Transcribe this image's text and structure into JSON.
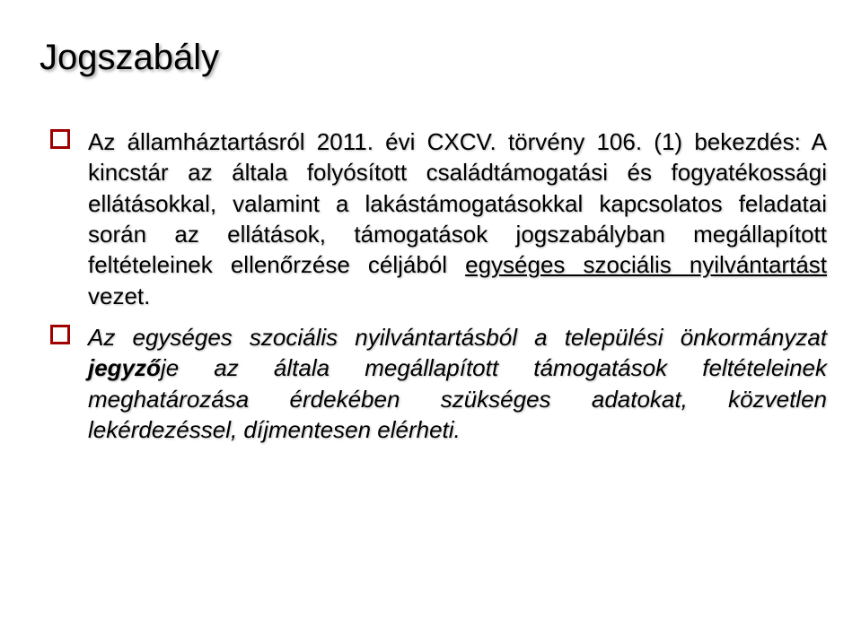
{
  "title": "Jogszabály",
  "items": [
    {
      "segments": [
        {
          "text": "Az államháztartásról 2011. évi CXCV. törvény 106. (1) bekezdés: A kincstár az általa folyósított családtámogatási és fogyatékossági ellátásokkal, valamint a lakástámogatásokkal kapcsolatos feladatai során az ellátások, támogatások jogszabályban megállapított feltételeinek ellenőrzése céljából ",
          "underline": false,
          "bold": false,
          "italic": false
        },
        {
          "text": "egységes szociális nyilvántartást",
          "underline": true,
          "bold": false,
          "italic": false
        },
        {
          "text": " vezet.",
          "underline": false,
          "bold": false,
          "italic": false
        }
      ]
    },
    {
      "segments": [
        {
          "text": "Az egységes szociális nyilvántartásból a települési önkormányzat ",
          "underline": false,
          "bold": false,
          "italic": true
        },
        {
          "text": "jegyző",
          "underline": false,
          "bold": true,
          "italic": true
        },
        {
          "text": "je az általa megállapított támogatások feltételeinek meghatározása érdekében szükséges adatokat, közvetlen lekérdezéssel, díjmentesen elérheti.",
          "underline": false,
          "bold": false,
          "italic": true
        }
      ]
    }
  ]
}
